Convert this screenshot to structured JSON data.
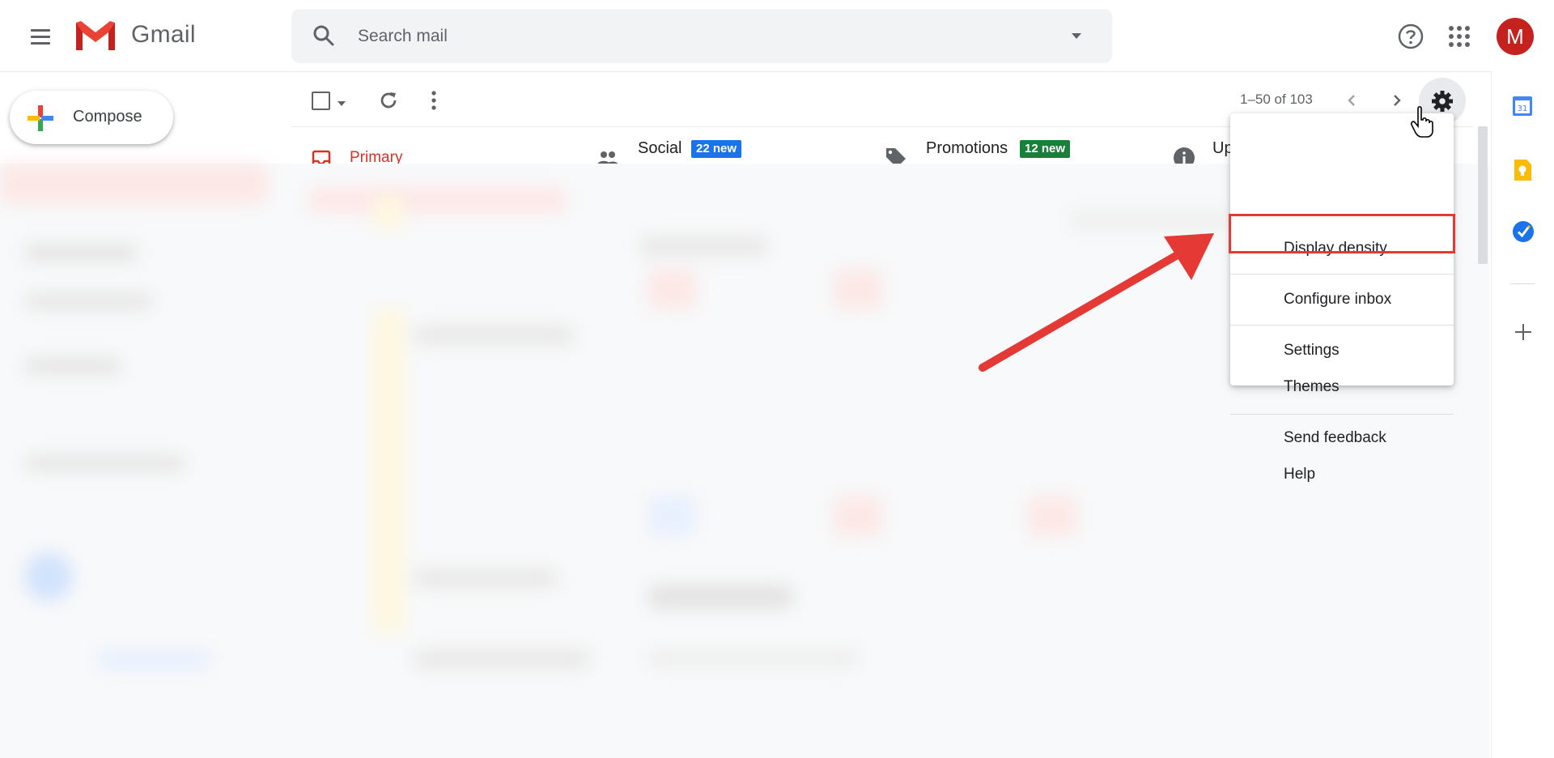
{
  "header": {
    "app_name": "Gmail",
    "search_placeholder": "Search mail",
    "avatar_letter": "M"
  },
  "compose": {
    "label": "Compose"
  },
  "toolbar": {
    "pagination": "1–50 of 103"
  },
  "tabs": [
    {
      "label": "Primary",
      "icon": "inbox-icon",
      "color": "#d93025"
    },
    {
      "label": "Social",
      "badge": "22 new",
      "badge_color": "#1a73e8",
      "icon": "people-icon"
    },
    {
      "label": "Promotions",
      "badge": "12 new",
      "badge_color": "#188038",
      "icon": "tag-icon"
    },
    {
      "label": "Up",
      "icon": "info-icon"
    }
  ],
  "settings_menu": {
    "items": [
      {
        "label": "Display density"
      },
      {
        "label": "Configure inbox"
      },
      {
        "label": "Settings",
        "highlighted": true
      },
      {
        "label": "Themes"
      },
      {
        "label": "Send feedback"
      },
      {
        "label": "Help"
      }
    ]
  },
  "side_panel": {
    "icons": [
      "calendar-icon",
      "keep-icon",
      "tasks-icon",
      "add-addons-icon"
    ],
    "calendar_date": "31"
  },
  "colors": {
    "accent_red": "#d93025",
    "annotation_red": "#e53935",
    "avatar_bg": "#c5221f"
  }
}
